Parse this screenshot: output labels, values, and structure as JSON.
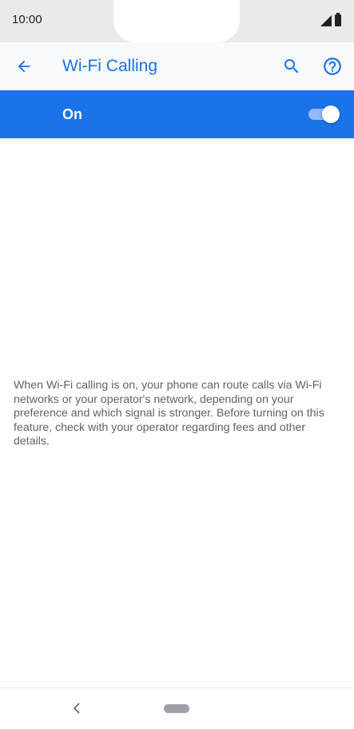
{
  "status_bar": {
    "time": "10:00",
    "icons": [
      "signal-icon",
      "battery-icon"
    ]
  },
  "app_bar": {
    "title": "Wi-Fi Calling",
    "back_icon": "arrow-back-icon",
    "search_icon": "search-icon",
    "help_icon": "help-icon"
  },
  "master_switch": {
    "label": "On",
    "checked": true
  },
  "description": "When Wi-Fi calling is on, your phone can route calls via Wi-Fi networks or your operator's network, depending on your preference and which signal is stronger. Before turning on this feature, check with your operator regarding fees and other details.",
  "nav_bar": {
    "back_icon": "chevron-left-icon",
    "home_icon": "home-pill-icon"
  },
  "colors": {
    "accent": "#1a73e8",
    "app_bar_bg": "#f8f9fa",
    "status_bar_bg": "#e8eaed",
    "body_text": "#5f6368"
  }
}
